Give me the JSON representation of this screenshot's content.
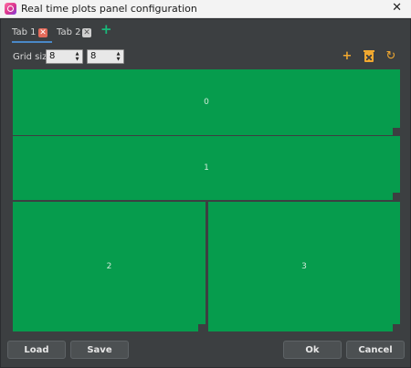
{
  "window": {
    "title": "Real time plots panel configuration",
    "close_glyph": "✕",
    "icon": "app-logo"
  },
  "tabs": [
    {
      "label": "Tab 1",
      "close_glyph": "✕",
      "active": true
    },
    {
      "label": "Tab 2",
      "close_glyph": "✕",
      "active": false
    }
  ],
  "tab_add_glyph": "+",
  "grid": {
    "label": "Grid size",
    "rows": "8",
    "cols": "8"
  },
  "toolbar": {
    "add_glyph": "+",
    "delete_icon": "trash-icon",
    "refresh_glyph": "↻"
  },
  "cells": [
    {
      "label": "0"
    },
    {
      "label": "1"
    },
    {
      "label": "2"
    },
    {
      "label": "3"
    }
  ],
  "buttons": {
    "load": "Load",
    "save": "Save",
    "ok": "Ok",
    "cancel": "Cancel"
  },
  "colors": {
    "cell": "#069c4d",
    "accent": "#f0a830",
    "tab_add": "#19b87a",
    "background": "#3c3f41"
  }
}
